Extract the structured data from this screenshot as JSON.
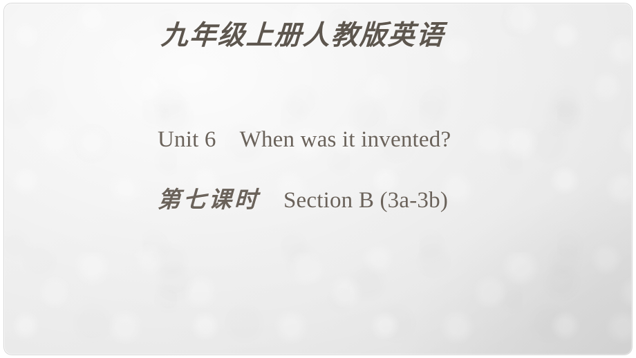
{
  "slide": {
    "header": {
      "title": "九年级上册人教版英语"
    },
    "body": {
      "unit_line": {
        "unit_label": "Unit 6",
        "unit_topic": "When was it invented?"
      },
      "lesson_line": {
        "period_label": "第七课时",
        "section_label": "Section B (3a-3b)"
      }
    },
    "colors": {
      "background_light": "#ececec",
      "background_dark": "#dedede",
      "header_text": "#5d564e",
      "body_text": "#6a625a",
      "frame": "#ffffff"
    }
  }
}
